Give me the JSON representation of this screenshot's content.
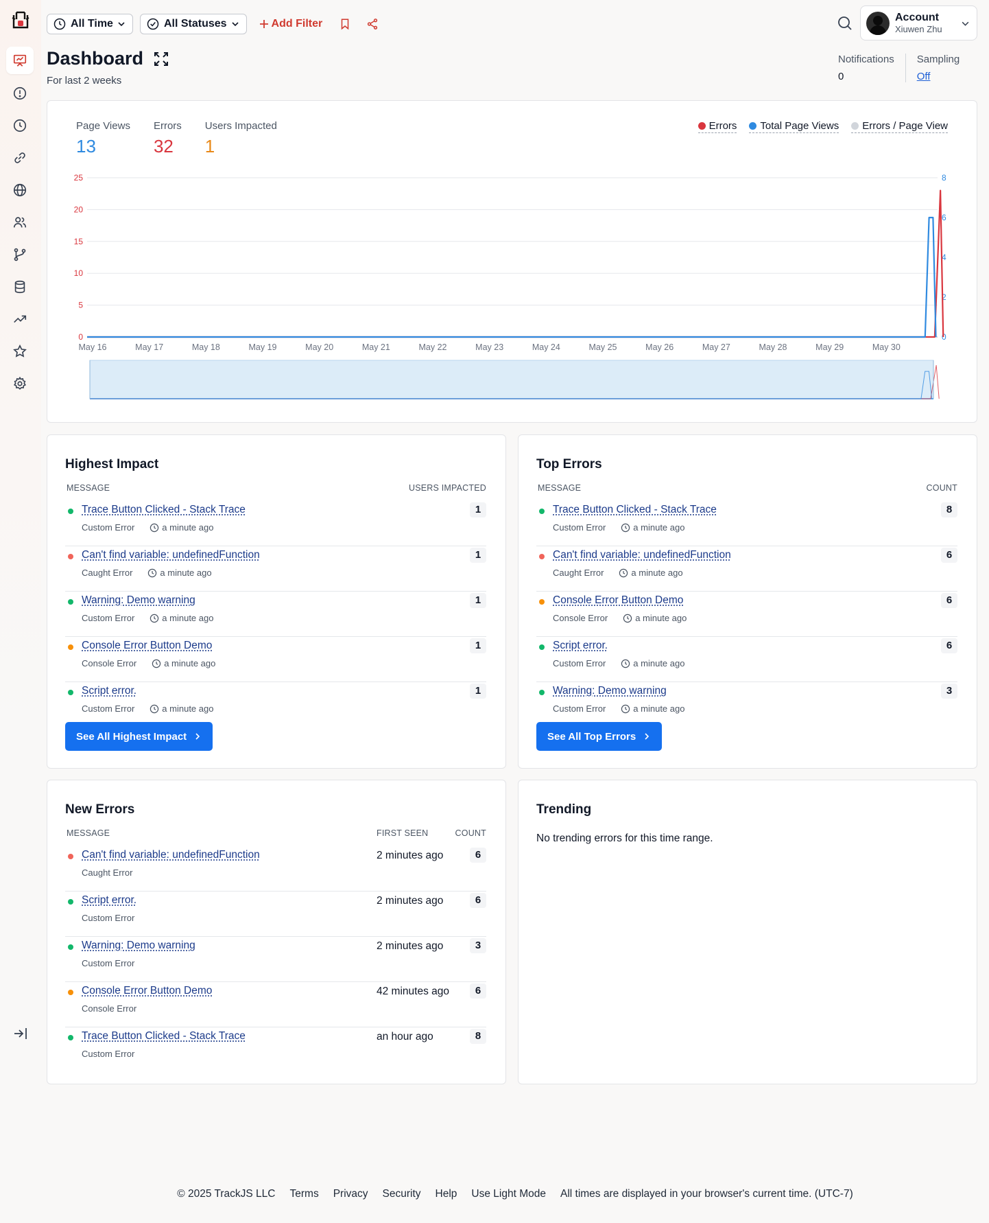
{
  "toolbar": {
    "time_filter": "All Time",
    "status_filter": "All Statuses",
    "add_filter": "Add Filter"
  },
  "account": {
    "title": "Account",
    "name": "Xiuwen Zhu"
  },
  "header": {
    "title": "Dashboard",
    "subtitle": "For last 2 weeks",
    "notifications_label": "Notifications",
    "notifications_value": "0",
    "sampling_label": "Sampling",
    "sampling_value": "Off"
  },
  "kpis": {
    "page_views_label": "Page Views",
    "page_views_value": "13",
    "errors_label": "Errors",
    "errors_value": "32",
    "users_label": "Users Impacted",
    "users_value": "1"
  },
  "colors": {
    "errors": "#d9363e",
    "page_views": "#2f8ae0",
    "errors_per_view": "#d1d5db",
    "users": "#e8891a",
    "primary": "#1570ef"
  },
  "chart_data": {
    "type": "line",
    "legend": [
      "Errors",
      "Total Page Views",
      "Errors / Page View"
    ],
    "legend_position": "top-right",
    "categories": [
      "May 16",
      "May 17",
      "May 18",
      "May 19",
      "May 20",
      "May 21",
      "May 22",
      "May 23",
      "May 24",
      "May 25",
      "May 26",
      "May 27",
      "May 28",
      "May 29",
      "May 30"
    ],
    "left_ticks": [
      "0",
      "5",
      "10",
      "15",
      "20",
      "25"
    ],
    "right_ticks": [
      "0",
      "2",
      "4",
      "6",
      "8"
    ],
    "ylim_left": [
      0,
      25
    ],
    "ylim_right": [
      0,
      8
    ],
    "grid": true,
    "series": [
      {
        "name": "Errors",
        "axis": "left",
        "color": "#d9363e",
        "points": [
          [
            0,
            0
          ],
          [
            14.95,
            0
          ],
          [
            15.05,
            23
          ],
          [
            15.1,
            0
          ]
        ]
      },
      {
        "name": "Total Page Views",
        "axis": "right",
        "color": "#2f8ae0",
        "points": [
          [
            0,
            0
          ],
          [
            14.78,
            0
          ],
          [
            14.85,
            6
          ],
          [
            14.92,
            6
          ],
          [
            14.97,
            0
          ]
        ]
      }
    ]
  },
  "highest_impact": {
    "title": "Highest Impact",
    "col_message": "MESSAGE",
    "col_value": "USERS IMPACTED",
    "button": "See All Highest Impact",
    "rows": [
      {
        "message": "Trace Button Clicked - Stack Trace",
        "type": "Custom Error",
        "time": "a minute ago",
        "value": "1",
        "color": "#12b76a"
      },
      {
        "message": "Can't find variable: undefinedFunction",
        "type": "Caught Error",
        "time": "a minute ago",
        "value": "1",
        "color": "#f0645a"
      },
      {
        "message": "Warning: Demo warning",
        "type": "Custom Error",
        "time": "a minute ago",
        "value": "1",
        "color": "#12b76a"
      },
      {
        "message": "Console Error Button Demo",
        "type": "Console Error",
        "time": "a minute ago",
        "value": "1",
        "color": "#f79009"
      },
      {
        "message": "Script error.",
        "type": "Custom Error",
        "time": "a minute ago",
        "value": "1",
        "color": "#12b76a"
      }
    ]
  },
  "top_errors": {
    "title": "Top Errors",
    "col_message": "MESSAGE",
    "col_value": "COUNT",
    "button": "See All Top Errors",
    "rows": [
      {
        "message": "Trace Button Clicked - Stack Trace",
        "type": "Custom Error",
        "time": "a minute ago",
        "value": "8",
        "color": "#12b76a"
      },
      {
        "message": "Can't find variable: undefinedFunction",
        "type": "Caught Error",
        "time": "a minute ago",
        "value": "6",
        "color": "#f0645a"
      },
      {
        "message": "Console Error Button Demo",
        "type": "Console Error",
        "time": "a minute ago",
        "value": "6",
        "color": "#f79009"
      },
      {
        "message": "Script error.",
        "type": "Custom Error",
        "time": "a minute ago",
        "value": "6",
        "color": "#12b76a"
      },
      {
        "message": "Warning: Demo warning",
        "type": "Custom Error",
        "time": "a minute ago",
        "value": "3",
        "color": "#12b76a"
      }
    ]
  },
  "new_errors": {
    "title": "New Errors",
    "col_message": "MESSAGE",
    "col_first_seen": "FIRST SEEN",
    "col_count": "COUNT",
    "rows": [
      {
        "message": "Can't find variable: undefinedFunction",
        "type": "Caught Error",
        "first_seen": "2 minutes ago",
        "count": "6",
        "color": "#f0645a"
      },
      {
        "message": "Script error.",
        "type": "Custom Error",
        "first_seen": "2 minutes ago",
        "count": "6",
        "color": "#12b76a"
      },
      {
        "message": "Warning: Demo warning",
        "type": "Custom Error",
        "first_seen": "2 minutes ago",
        "count": "3",
        "color": "#12b76a"
      },
      {
        "message": "Console Error Button Demo",
        "type": "Console Error",
        "first_seen": "42 minutes ago",
        "count": "6",
        "color": "#f79009"
      },
      {
        "message": "Trace Button Clicked - Stack Trace",
        "type": "Custom Error",
        "first_seen": "an hour ago",
        "count": "8",
        "color": "#12b76a"
      }
    ]
  },
  "trending": {
    "title": "Trending",
    "empty": "No trending errors for this time range."
  },
  "footer": {
    "copyright": "© 2025 TrackJS LLC",
    "terms": "Terms",
    "privacy": "Privacy",
    "security": "Security",
    "help": "Help",
    "light_mode": "Use Light Mode",
    "timezone_note": "All times are displayed in your browser's current time. (UTC-7)"
  },
  "icons": {
    "sidebar": [
      "dashboard-icon",
      "alert-icon",
      "clock-icon",
      "link-icon",
      "globe-icon",
      "users-icon",
      "branch-icon",
      "database-icon",
      "trending-icon",
      "star-icon",
      "gear-icon"
    ]
  }
}
